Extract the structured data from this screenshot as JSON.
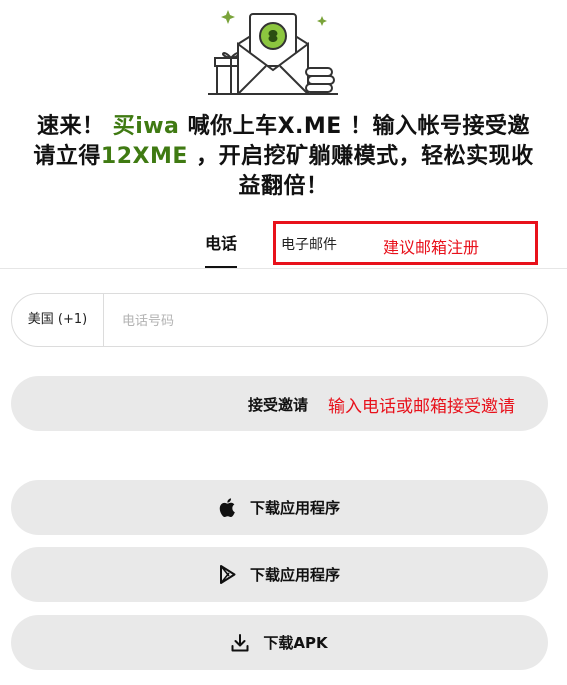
{
  "hero": {
    "illustration": "envelope-with-coin-gift-icon"
  },
  "headline": {
    "line1_a": "速来！",
    "line1_name": "买iwa",
    "line1_b": "喊你上车X.ME ！输入帐号接受邀",
    "line2_a": "请立得",
    "line2_reward": "12XME",
    "line2_b": "，开启挖矿躺赚模式，轻松实现收",
    "line3": "益翻倍！"
  },
  "tabs": {
    "phone": "电话",
    "email": "电子邮件"
  },
  "annotations": {
    "email_tip": "建议邮箱注册",
    "accept_tip": "输入电话或邮箱接受邀请",
    "color": "#e8111b"
  },
  "phone_form": {
    "country_code": "美国 (+1)",
    "placeholder": "电话号码",
    "value": ""
  },
  "buttons": {
    "accept": "接受邀请",
    "ios": "下载应用程序",
    "android": "下载应用程序",
    "apk": "下载APK"
  },
  "icons": {
    "ios": "apple-icon",
    "android": "google-play-icon",
    "apk": "download-icon"
  },
  "colors": {
    "accent_green": "#3f7a12",
    "button_bg": "#e9e9e9",
    "annotation_red": "#e8111b"
  }
}
